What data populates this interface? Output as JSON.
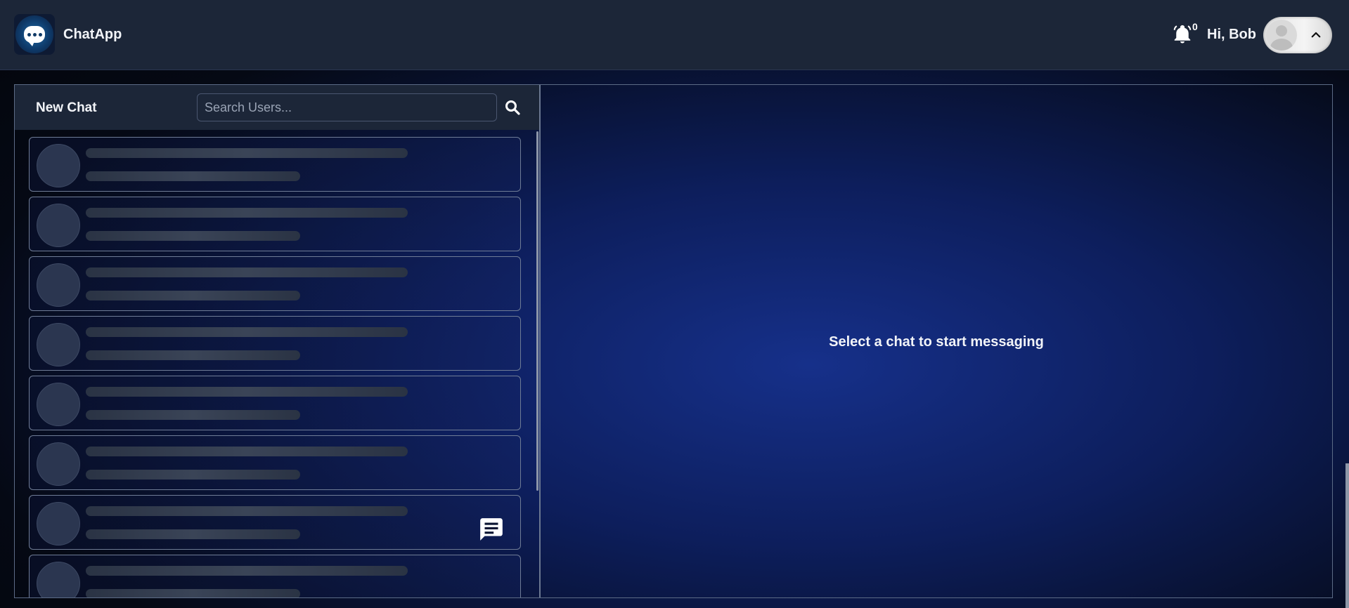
{
  "header": {
    "app_name": "ChatApp",
    "notification_count": "0",
    "greeting": "Hi, Bob"
  },
  "sidebar": {
    "new_chat_label": "New Chat",
    "search_placeholder": "Search Users...",
    "search_value": "",
    "loading_items_count": 8
  },
  "main": {
    "empty_state": "Select a chat to start messaging"
  },
  "icons": {
    "logo": "chat-bubble-logo-icon",
    "notifications": "bell-icon",
    "avatar": "user-avatar-icon",
    "toggle": "chevron-up-icon",
    "search": "search-icon",
    "new_message": "message-icon"
  },
  "colors": {
    "header_bg": "#1c2638",
    "accent_blue": "#16308a",
    "text": "#f2f4f8"
  }
}
